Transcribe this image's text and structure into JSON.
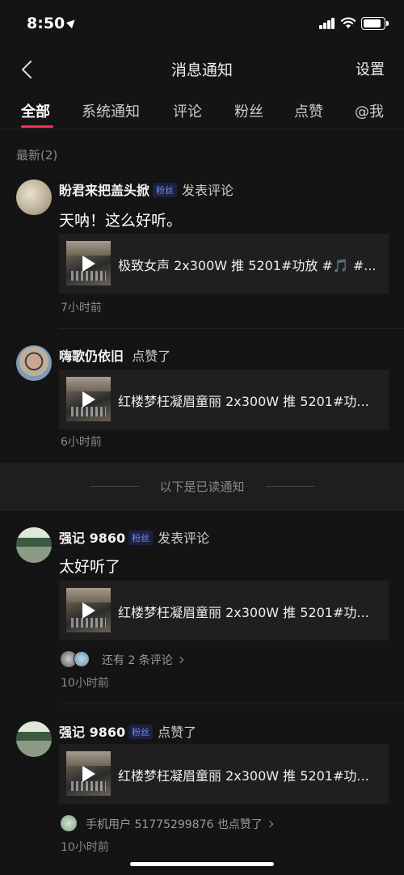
{
  "status_bar": {
    "time": "8:50"
  },
  "header": {
    "title": "消息通知",
    "settings": "设置"
  },
  "tabs": [
    {
      "label": "全部",
      "active": true
    },
    {
      "label": "系统通知",
      "active": false
    },
    {
      "label": "评论",
      "active": false
    },
    {
      "label": "粉丝",
      "active": false
    },
    {
      "label": "点赞",
      "active": false
    },
    {
      "label": "@我",
      "active": false
    }
  ],
  "section_latest": "最新(2)",
  "read_divider": "以下是已读通知",
  "notifications": [
    {
      "user": "盼君来把盖头掀",
      "badge": "粉丝",
      "action": "发表评论",
      "comment": "天呐！这么好听。",
      "video_title": "极致女声 2x300W 推 5201#功放 #🎵 #...",
      "time": "7小时前"
    },
    {
      "user": "嗨歌仍依旧",
      "action": "点赞了",
      "video_title": "红楼梦枉凝眉童丽 2x300W 推 5201#功...",
      "time": "6小时前"
    },
    {
      "user": "强记 9860",
      "badge": "粉丝",
      "action": "发表评论",
      "comment": "太好听了",
      "video_title": "红楼梦枉凝眉童丽 2x300W 推 5201#功...",
      "more": "还有 2 条评论",
      "time": "10小时前"
    },
    {
      "user": "强记 9860",
      "badge": "粉丝",
      "action": "点赞了",
      "video_title": "红楼梦枉凝眉童丽 2x300W 推 5201#功...",
      "more": "手机用户 51775299876 也点赞了",
      "time": "10小时前"
    }
  ],
  "colors": {
    "accent": "#fe2c55",
    "badge_text": "#6a8cf0",
    "background": "#141414"
  }
}
